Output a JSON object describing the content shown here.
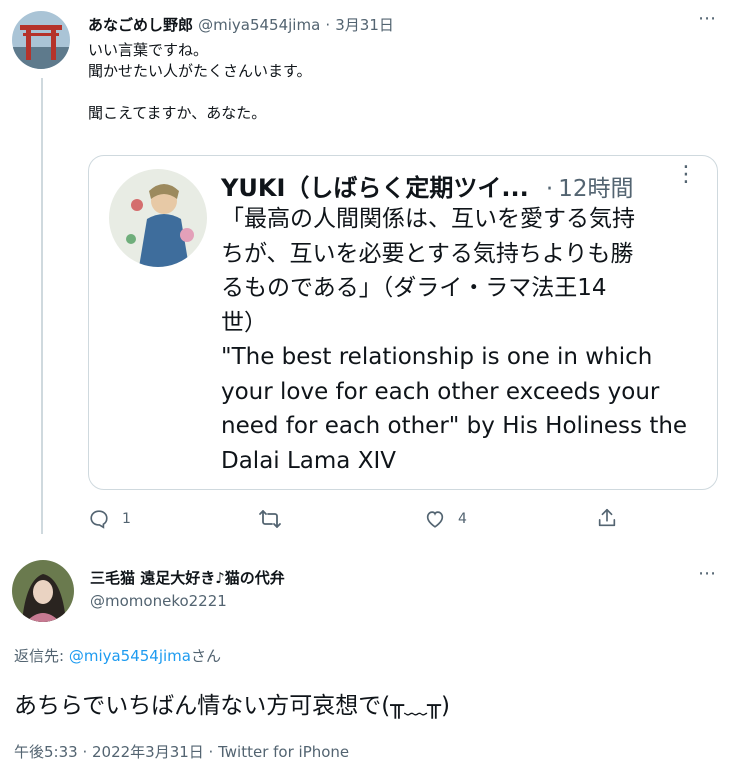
{
  "tweet1": {
    "display_name": "あなごめし野郎",
    "handle": "@miya5454jima",
    "separator": "·",
    "date": "3月31日",
    "text_lines": [
      "いい言葉ですね。",
      "聞かせたい人がたくさんいます。",
      "",
      "聞こえてますか、あなた。"
    ]
  },
  "quoted": {
    "display_name": "YUKI（しばらく定期ツイ...",
    "separator": "·",
    "time": "12時間",
    "text_lines": [
      "「最高の人間関係は、互いを愛する気持",
      "ちが、互いを必要とする気持ちよりも勝",
      "るものである」（ダライ・ラマ法王14",
      "世）",
      "\"The best relationship is one in which",
      "your love for each other exceeds your",
      "need for each other\" by His Holiness the",
      "Dalai Lama XIV"
    ]
  },
  "actions": {
    "reply_count": "1",
    "like_count": "4"
  },
  "tweet2": {
    "display_name": "三毛猫 遠足大好き♪猫の代弁",
    "handle": "@momoneko2221",
    "reply_to_prefix": "返信先: ",
    "reply_to_handle": "@miya5454jima",
    "reply_to_suffix": "さん",
    "text": "あちらでいちばん情ない方可哀想で(╥﹏╥)",
    "timestamp": "午後5:33 · 2022年3月31日 · Twitter for iPhone"
  },
  "colors": {
    "accent": "#1d9bf0",
    "muted": "#536471",
    "border": "#cfd9de"
  }
}
